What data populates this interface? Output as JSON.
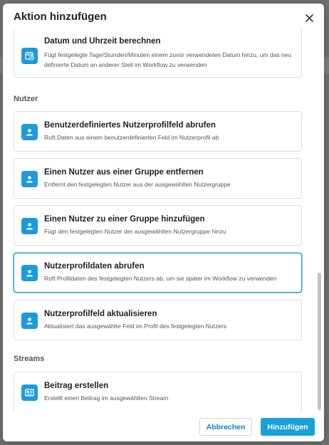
{
  "modal": {
    "title": "Aktion hinzufügen",
    "close_icon": "close-icon"
  },
  "partial_card": {
    "title": "Datum und Uhrzeit berechnen",
    "description": "Fügt festgelegte Tage/Stunden/Minuten einem zuvor verwendeten Datum hinzu, um das neu definierte Datum an anderer Stell im Workflow zu verwenden",
    "icon": "calendar-clock-icon"
  },
  "sections": [
    {
      "label": "Nutzer",
      "actions": [
        {
          "title": "Benutzerdefiniertes Nutzerprofilfeld abrufen",
          "description": "Ruft Daten aus einem benutzerdefinierten Feld im Nutzerprofil ab",
          "icon": "user-icon"
        },
        {
          "title": "Einen Nutzer aus einer Gruppe entfernen",
          "description": "Entfernt den festgelegten Nutzer aus der ausgewählten Nutzergruppe",
          "icon": "user-icon"
        },
        {
          "title": "Einen Nutzer zu einer Gruppe hinzufügen",
          "description": "Fügt den festgelegten Nutzer der ausgewählten Nutzergruppe hinzu",
          "icon": "user-icon"
        },
        {
          "title": "Nutzerprofildaten abrufen",
          "description": "Ruft Profildaten des festgelegten Nutzers ab, um sie später im Workflow zu verwenden",
          "icon": "user-icon",
          "selected": true
        },
        {
          "title": "Nutzerprofilfeld aktualisieren",
          "description": "Aktualisiert das ausgewählte Feld im Profil des festgelegten Nutzers",
          "icon": "user-icon"
        }
      ]
    },
    {
      "label": "Streams",
      "actions": [
        {
          "title": "Beitrag erstellen",
          "description": "Erstellt einen Beitrag im ausgewählten Stream",
          "icon": "post-card-icon"
        }
      ]
    }
  ],
  "footer": {
    "cancel_label": "Abbrechen",
    "add_label": "Hinzufügen"
  },
  "colors": {
    "accent": "#1aa0d8",
    "icon_bg": "#1c9bd8",
    "overlay": "#6f6f6f"
  }
}
